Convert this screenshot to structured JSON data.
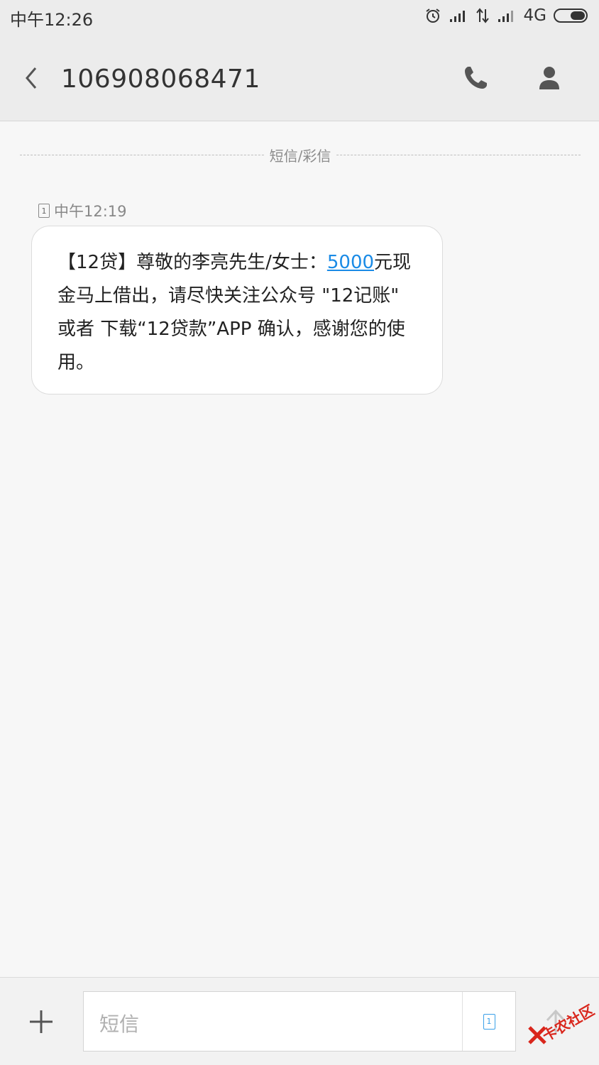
{
  "status_bar": {
    "time": "中午12:26",
    "network": "4G"
  },
  "header": {
    "contact_number": "106908068471",
    "icons": [
      "back-arrow-icon",
      "phone-icon",
      "person-icon"
    ]
  },
  "thread": {
    "divider_label": "短信/彩信",
    "messages": [
      {
        "sim_slot": "1",
        "time": "中午12:19",
        "text_before": "【12贷】尊敬的李亮先生/女士：",
        "amount_link": "5000",
        "text_after": "元现金马上借出，请尽快关注公众号 \"12记账\" 或者 下载“12贷款”APP 确认，感谢您的使用。"
      }
    ]
  },
  "composer": {
    "placeholder": "短信",
    "sim_slot": "1",
    "icons": [
      "plus-icon",
      "sim-card-icon",
      "send-icon"
    ]
  },
  "watermark": {
    "text": "卡农社区"
  },
  "colors": {
    "link": "#1a8be6",
    "watermark": "#d9261c",
    "background": "#f7f7f7"
  }
}
